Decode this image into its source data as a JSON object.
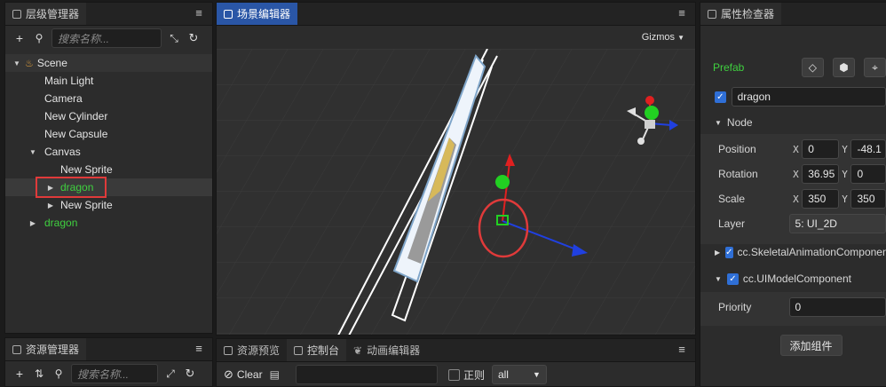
{
  "hierarchy": {
    "title": "层级管理器",
    "search_placeholder": "搜索名称...",
    "items": [
      {
        "label": "Scene",
        "depth": 0,
        "arrow": "▼",
        "icon": "scene-icon"
      },
      {
        "label": "Main Light",
        "depth": 1,
        "arrow": ""
      },
      {
        "label": "Camera",
        "depth": 1,
        "arrow": ""
      },
      {
        "label": "New Cylinder",
        "depth": 1,
        "arrow": ""
      },
      {
        "label": "New Capsule",
        "depth": 1,
        "arrow": ""
      },
      {
        "label": "Canvas",
        "depth": 1,
        "arrow": "▼"
      },
      {
        "label": "New Sprite",
        "depth": 2,
        "arrow": ""
      },
      {
        "label": "dragon",
        "depth": 2,
        "arrow": "▶",
        "color": "#3fd03f",
        "highlight": true
      },
      {
        "label": "New Sprite",
        "depth": 2,
        "arrow": "▶"
      },
      {
        "label": "dragon",
        "depth": 1,
        "arrow": "▶",
        "color": "#3fd03f"
      }
    ]
  },
  "assets": {
    "title": "资源管理器",
    "search_placeholder": "搜索名称..."
  },
  "scene": {
    "title": "场景编辑器",
    "gizmos_label": "Gizmos"
  },
  "bottom": {
    "tabs": [
      "资源预览",
      "控制台",
      "动画编辑器"
    ],
    "clear_label": "Clear",
    "regex_label": "正则",
    "filter_value": "all"
  },
  "inspector": {
    "title": "属性检查器",
    "prefab_label": "Prefab",
    "node_name": "dragon",
    "node_section": "Node",
    "position_label": "Position",
    "position_x": "0",
    "position_y": "-48.1",
    "rotation_label": "Rotation",
    "rotation_x": "36.95",
    "rotation_y": "0",
    "scale_label": "Scale",
    "scale_x": "350",
    "scale_y": "350",
    "layer_label": "Layer",
    "layer_value": "5: UI_2D",
    "comp1": "cc.SkeletalAnimationComponent",
    "comp2": "cc.UIModelComponent",
    "priority_label": "Priority",
    "priority_value": "0",
    "add_component": "添加组件",
    "axis_x": "X",
    "axis_y": "Y"
  },
  "colors": {
    "accent_tab": "#2a56a6",
    "prefab_green": "#3fd03f",
    "highlight_red": "#e03a3a"
  }
}
